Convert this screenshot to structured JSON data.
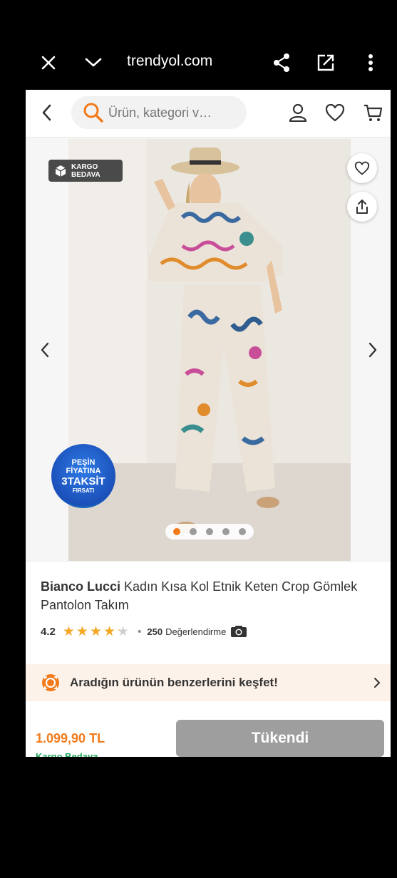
{
  "browser": {
    "url": "trendyol.com"
  },
  "header": {
    "search_placeholder": "Ürün, kategori v…"
  },
  "gallery": {
    "kargo_badge_line1": "KARGO",
    "kargo_badge_line2": "BEDAVA",
    "pesin_line1": "PEŞİN",
    "pesin_line2": "FİYATINA",
    "pesin_line3": "3TAKSİT",
    "pesin_line4": "FIRSATI",
    "image_count": 5,
    "active_image": 1
  },
  "product": {
    "brand": "Bianco Lucci",
    "name": " Kadın Kısa Kol Etnik Keten Crop Gömlek Pantolon Takım",
    "rating": "4.2",
    "rating_value": 4.2,
    "review_count": "250",
    "review_label": "Değerlendirme"
  },
  "discover": {
    "label": "Aradığın ürünün benzerlerini keşfet!"
  },
  "purchase": {
    "price": "1.099,90 TL",
    "shipping": "Kargo Bedava",
    "button_label": "Tükendi"
  },
  "colors": {
    "accent": "#f27a1a",
    "disabled_button": "#9e9e9e",
    "star": "#f5a623",
    "discover_bg": "#fdf2e9"
  }
}
